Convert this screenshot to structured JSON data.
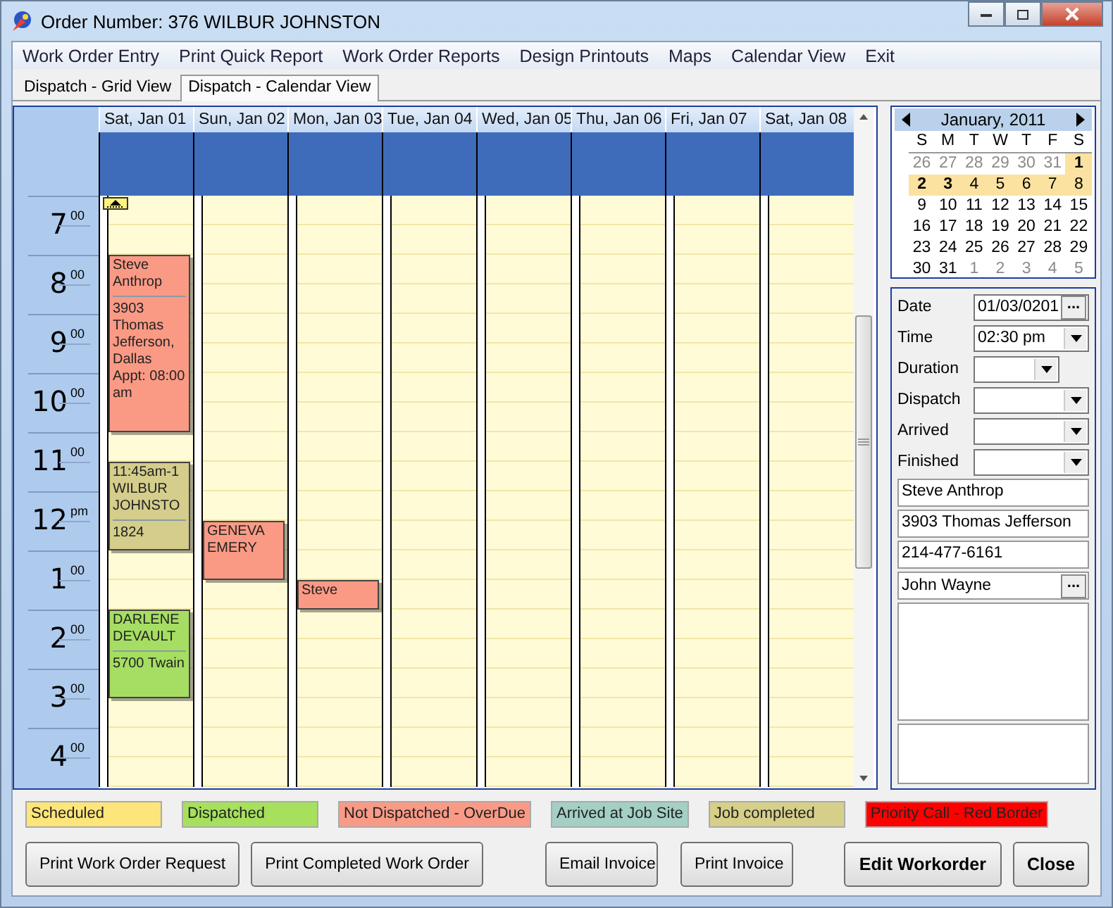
{
  "window": {
    "title": "Order Number: 376 WILBUR JOHNSTON"
  },
  "menu": [
    "Work Order Entry",
    "Print Quick Report",
    "Work Order Reports",
    "Design Printouts",
    "Maps",
    "Calendar View",
    "Exit"
  ],
  "tabs": [
    {
      "label": "Dispatch - Grid View",
      "selected": false
    },
    {
      "label": "Dispatch - Calendar View",
      "selected": true
    }
  ],
  "calendar": {
    "hours": [
      {
        "hour": "7",
        "suffix": "00"
      },
      {
        "hour": "8",
        "suffix": "00"
      },
      {
        "hour": "9",
        "suffix": "00"
      },
      {
        "hour": "10",
        "suffix": "00"
      },
      {
        "hour": "11",
        "suffix": "00"
      },
      {
        "hour": "12",
        "suffix": "pm"
      },
      {
        "hour": "1",
        "suffix": "00"
      },
      {
        "hour": "2",
        "suffix": "00"
      },
      {
        "hour": "3",
        "suffix": "00"
      },
      {
        "hour": "4",
        "suffix": "00"
      }
    ],
    "days": [
      {
        "label": "Sat, Jan 01",
        "more_above": true,
        "events": [
          {
            "color": "#fa9a85",
            "title": "Steve Anthrop",
            "detail": "3903 Thomas Jefferson, Dallas Appt: 08:00 am"
          },
          {
            "color": "#d4cd8b",
            "title": "11:45am-1 WILBUR JOHNSTO",
            "detail": "1824"
          },
          {
            "color": "#a5de63",
            "title": "DARLENE DEVAULT",
            "detail": "5700 Twain"
          }
        ]
      },
      {
        "label": "Sun, Jan 02",
        "more_above": false,
        "events": [
          {
            "color": "#fa9a85",
            "title": "GENEVA EMERY"
          }
        ]
      },
      {
        "label": "Mon, Jan 03",
        "more_above": false,
        "events": [
          {
            "color": "#fa9a85",
            "title": "Steve"
          }
        ]
      },
      {
        "label": "Tue, Jan 04",
        "more_above": false
      },
      {
        "label": "Wed, Jan 05",
        "more_above": false
      },
      {
        "label": "Thu, Jan 06",
        "more_above": false
      },
      {
        "label": "Fri, Jan 07",
        "more_above": false
      },
      {
        "label": "Sat, Jan 08",
        "more_above": false
      }
    ]
  },
  "mini_calendar": {
    "month": "January, 2011",
    "weekdays": [
      "S",
      "M",
      "T",
      "W",
      "T",
      "F",
      "S"
    ],
    "weeks": [
      [
        {
          "d": "26",
          "other": true,
          "bold": false,
          "selected": false
        },
        {
          "d": "27",
          "other": true,
          "bold": false,
          "selected": false
        },
        {
          "d": "28",
          "other": true,
          "bold": false,
          "selected": false
        },
        {
          "d": "29",
          "other": true,
          "bold": false,
          "selected": false
        },
        {
          "d": "30",
          "other": true,
          "bold": false,
          "selected": false
        },
        {
          "d": "31",
          "other": true,
          "bold": false,
          "selected": false
        },
        {
          "d": "1",
          "other": false,
          "bold": true,
          "selected": true
        }
      ],
      [
        {
          "d": "2",
          "other": false,
          "bold": true,
          "selected": true
        },
        {
          "d": "3",
          "other": false,
          "bold": true,
          "selected": true
        },
        {
          "d": "4",
          "other": false,
          "bold": false,
          "selected": true
        },
        {
          "d": "5",
          "other": false,
          "bold": false,
          "selected": true
        },
        {
          "d": "6",
          "other": false,
          "bold": false,
          "selected": true
        },
        {
          "d": "7",
          "other": false,
          "bold": false,
          "selected": true
        },
        {
          "d": "8",
          "other": false,
          "bold": false,
          "selected": true
        }
      ],
      [
        {
          "d": "9",
          "other": false,
          "bold": false,
          "selected": false
        },
        {
          "d": "10",
          "other": false,
          "bold": false,
          "selected": false
        },
        {
          "d": "11",
          "other": false,
          "bold": false,
          "selected": false
        },
        {
          "d": "12",
          "other": false,
          "bold": false,
          "selected": false
        },
        {
          "d": "13",
          "other": false,
          "bold": false,
          "selected": false
        },
        {
          "d": "14",
          "other": false,
          "bold": false,
          "selected": false
        },
        {
          "d": "15",
          "other": false,
          "bold": false,
          "selected": false
        }
      ],
      [
        {
          "d": "16",
          "other": false,
          "bold": false,
          "selected": false
        },
        {
          "d": "17",
          "other": false,
          "bold": false,
          "selected": false
        },
        {
          "d": "18",
          "other": false,
          "bold": false,
          "selected": false
        },
        {
          "d": "19",
          "other": false,
          "bold": false,
          "selected": false
        },
        {
          "d": "20",
          "other": false,
          "bold": false,
          "selected": false
        },
        {
          "d": "21",
          "other": false,
          "bold": false,
          "selected": false
        },
        {
          "d": "22",
          "other": false,
          "bold": false,
          "selected": false
        }
      ],
      [
        {
          "d": "23",
          "other": false,
          "bold": false,
          "selected": false
        },
        {
          "d": "24",
          "other": false,
          "bold": false,
          "selected": false
        },
        {
          "d": "25",
          "other": false,
          "bold": false,
          "selected": false
        },
        {
          "d": "26",
          "other": false,
          "bold": false,
          "selected": false
        },
        {
          "d": "27",
          "other": false,
          "bold": false,
          "selected": false
        },
        {
          "d": "28",
          "other": false,
          "bold": false,
          "selected": false
        },
        {
          "d": "29",
          "other": false,
          "bold": false,
          "selected": false
        }
      ],
      [
        {
          "d": "30",
          "other": false,
          "bold": false,
          "selected": false
        },
        {
          "d": "31",
          "other": false,
          "bold": false,
          "selected": false
        },
        {
          "d": "1",
          "other": true,
          "bold": false,
          "selected": false
        },
        {
          "d": "2",
          "other": true,
          "bold": false,
          "selected": false
        },
        {
          "d": "3",
          "other": true,
          "bold": false,
          "selected": false
        },
        {
          "d": "4",
          "other": true,
          "bold": false,
          "selected": false
        },
        {
          "d": "5",
          "other": true,
          "bold": false,
          "selected": false
        }
      ]
    ]
  },
  "form": {
    "rows": [
      {
        "label": "Date",
        "kind": "picker",
        "value": "01/03/0201",
        "button": "..."
      },
      {
        "label": "Time",
        "kind": "dropdown",
        "value": "02:30 pm"
      },
      {
        "label": "Duration",
        "kind": "short-dropdown"
      },
      {
        "label": "Dispatch",
        "kind": "dropdown"
      },
      {
        "label": "Arrived",
        "kind": "dropdown"
      },
      {
        "label": "Finished",
        "kind": "dropdown"
      }
    ],
    "fields": [
      {
        "kind": "text",
        "value": "Steve Anthrop"
      },
      {
        "kind": "text",
        "value": "3903 Thomas Jefferson"
      },
      {
        "kind": "text",
        "value": "214-477-6161"
      },
      {
        "kind": "picker",
        "value": "John Wayne",
        "button": "..."
      },
      {
        "kind": "notes"
      },
      {
        "kind": "notes-small"
      }
    ]
  },
  "legend": [
    {
      "label": "Scheduled",
      "color": "#fde57a"
    },
    {
      "label": "Dispatched",
      "color": "#a6e05c"
    },
    {
      "label": "Not Dispatched - OverDue",
      "color": "#f99a86"
    },
    {
      "label": "Arrived at Job Site",
      "color": "#a3cfc4"
    },
    {
      "label": "Job completed",
      "color": "#d6cf8a"
    },
    {
      "label": "Priority Call - Red Border",
      "color": "#ff0000"
    }
  ],
  "buttons": [
    {
      "label": "Print Work Order Request",
      "kind": "normal"
    },
    {
      "label": "Print Completed Work Order",
      "kind": "normal"
    },
    {
      "label": "Email Invoice",
      "kind": "normal"
    },
    {
      "label": "Print Invoice",
      "kind": "normal"
    },
    {
      "label": "Edit Workorder",
      "kind": "default"
    },
    {
      "label": "Close",
      "kind": "default"
    }
  ]
}
